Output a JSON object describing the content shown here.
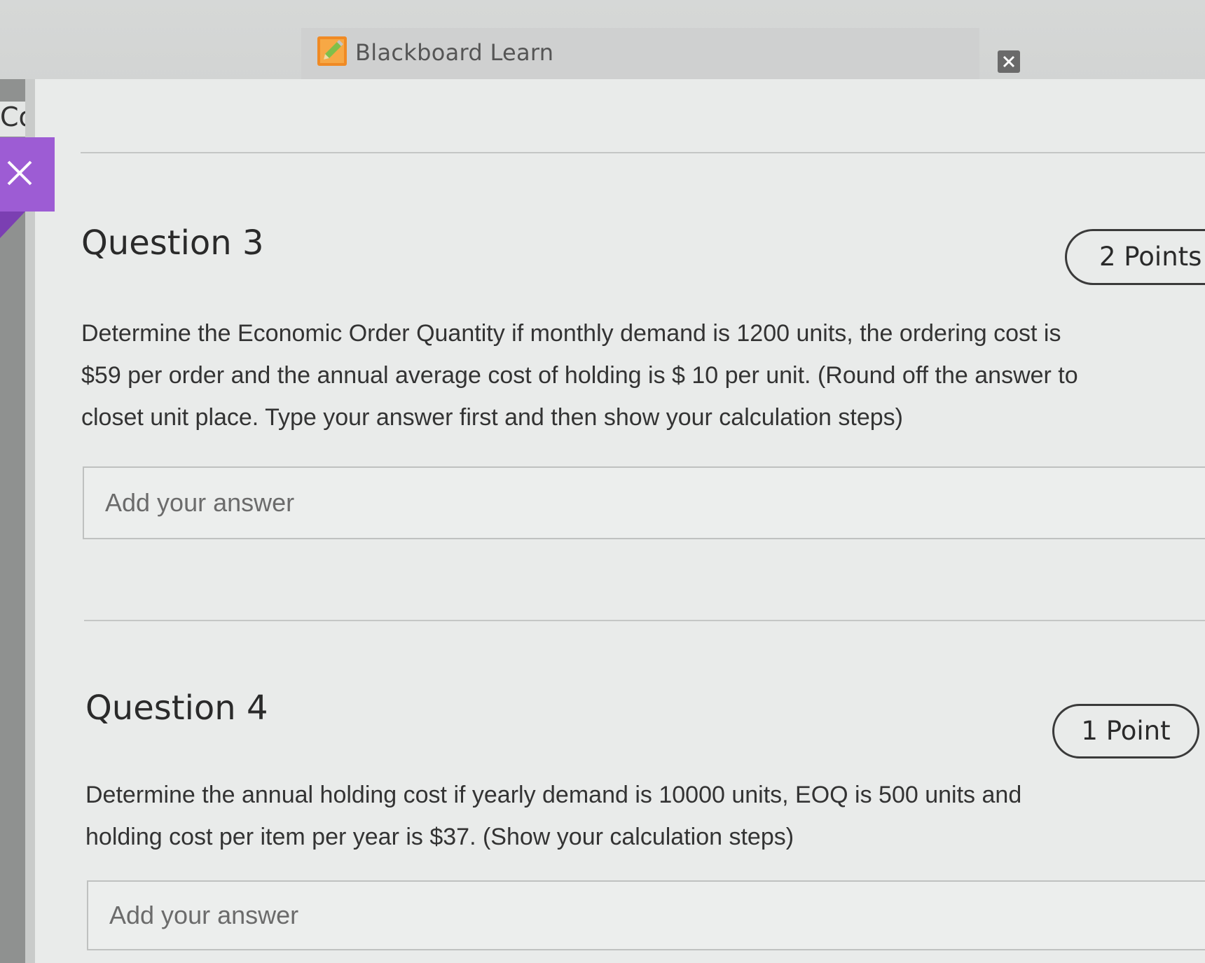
{
  "window": {
    "title": "Blackboard Learn",
    "icon": "pencil-icon",
    "close_icon": "close-icon"
  },
  "sidebar": {
    "partial_label": "Co",
    "close_icon": "close-x-icon",
    "accent": "#9d5cd4"
  },
  "questions": [
    {
      "title": "Question 3",
      "points": "2 Points",
      "line1": "Determine the Economic Order Quantity if monthly demand is 1200 units, the ordering cost is",
      "line2": "$59 per order and the annual average cost of holding is $ 10 per unit. (Round off the answer to",
      "line3": "closet unit place. Type your answer first and then show your calculation steps)",
      "answer_placeholder": "Add your answer"
    },
    {
      "title": "Question 4",
      "points": "1 Point",
      "line1": "Determine the annual holding cost if yearly demand is 10000 units, EOQ is 500 units and",
      "line2": "holding cost per item per year is $37. (Show your calculation steps)",
      "answer_placeholder": "Add your answer"
    }
  ]
}
